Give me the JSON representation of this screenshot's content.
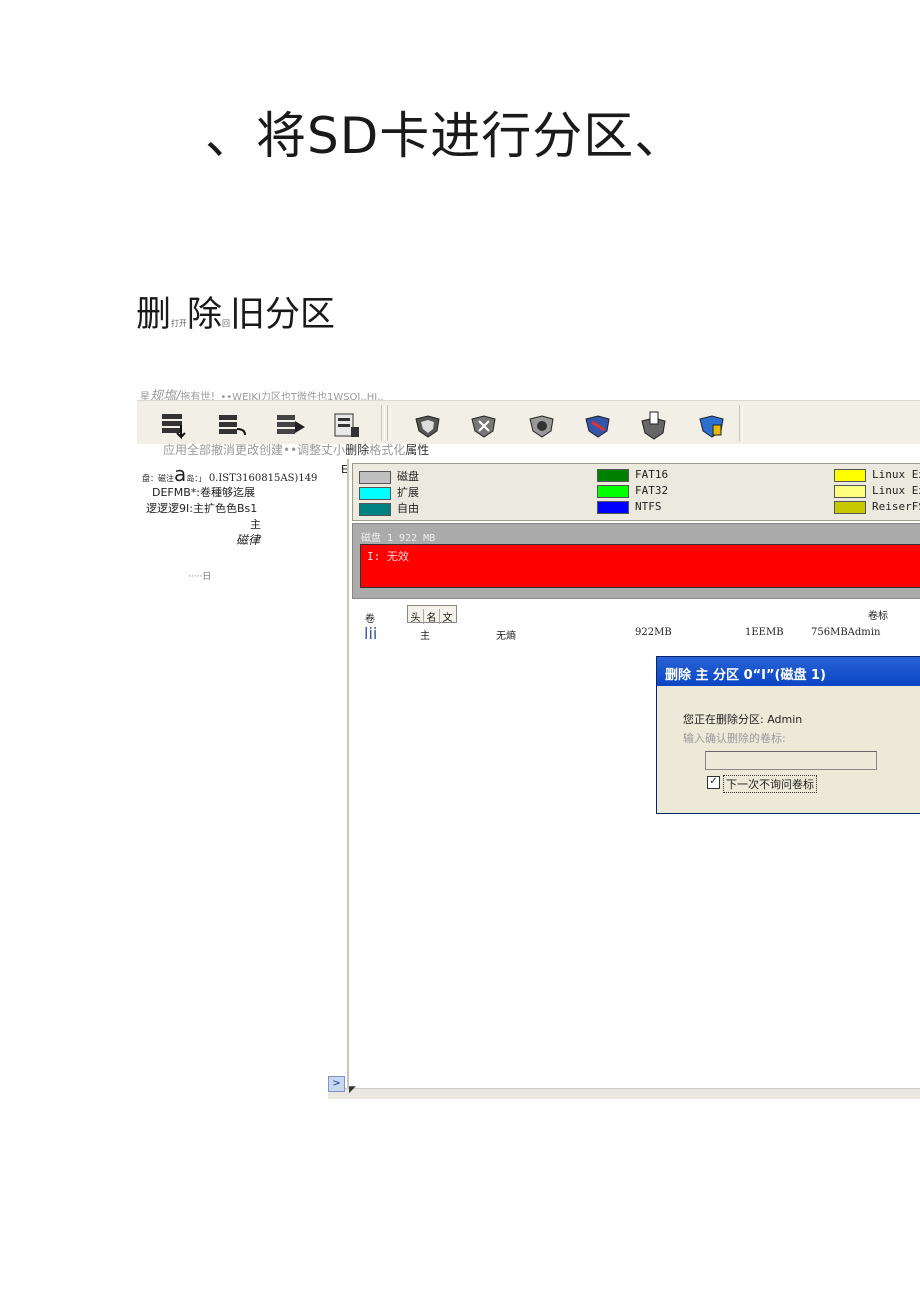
{
  "title": "、将SD卡进行分区、",
  "section": {
    "heading_a": "删",
    "heading_small_a": "打开",
    "heading_b": "除",
    "heading_small_b": "回",
    "heading_c": "旧分区"
  },
  "menubar": {
    "prefix": "星",
    "bold": "规塩/",
    "rest": "拖有世！••WEIKJ力区也T微件也1WSOI..HJ.."
  },
  "toolbar": {
    "icons": [
      "apply-icon",
      "undo-all-icon",
      "undo-icon",
      "create-icon",
      "resize-icon",
      "delete-icon",
      "format-icon",
      "properties-icon",
      "tool-icon",
      "info-icon"
    ],
    "labels_prefix": "应用全部撤消更改创建••调整丈小",
    "labels_dark": "删除",
    "labels_mid": "格式化",
    "labels_end": "属性"
  },
  "left_panel": {
    "line1_a": "盘：磁注",
    "line1_big": "a",
    "line1_b": "岛：」",
    "line1_c": "0.IST3160815AS)149",
    "line2": "DEFMB*:卷種够迄展",
    "line3": "逻逻逻9I:主扩色色Bs1",
    "line4": "主",
    "line5": "磁律",
    "line6": "·····日",
    "mark": "E"
  },
  "legend": {
    "items": [
      {
        "label": "磁盘",
        "color": "#c0c0c0"
      },
      {
        "label": "扩展",
        "color": "#00ffff"
      },
      {
        "label": "自由",
        "color": "#008080"
      },
      {
        "label": "FAT16",
        "color": "#008000"
      },
      {
        "label": "FAT32",
        "color": "#00ff00"
      },
      {
        "label": "NTFS",
        "color": "#0000ff"
      },
      {
        "label": "Linux Ex",
        "color": "#ffff00"
      },
      {
        "label": "Linux Ex",
        "color": "#ffff80"
      },
      {
        "label": "ReiserFS",
        "color": "#c8c800"
      }
    ]
  },
  "disk": {
    "label": "磁盘 1 922 MB",
    "partition_label": "I: 无效",
    "partition_color": "#ff0000"
  },
  "table": {
    "col_volume": "卷",
    "tabs": [
      "头",
      "名",
      "文"
    ],
    "col_label": "卷标",
    "row": {
      "icon": "lii",
      "type": "主",
      "fs": "无熵",
      "size": "922MB",
      "used": "1EEMB",
      "free_label": "756MBAdmin"
    }
  },
  "dialog": {
    "title": "删除 主 分区 0“I”(磁盘 1)",
    "message": "您正在删除分区: Admin",
    "prompt": "输入确认删除的卷标:",
    "input_value": "",
    "checkbox_mark": "✓",
    "checkbox_label": "下一次不询问卷标"
  },
  "footer": {
    "scroll_arrow": ">",
    "grip": "◤"
  }
}
